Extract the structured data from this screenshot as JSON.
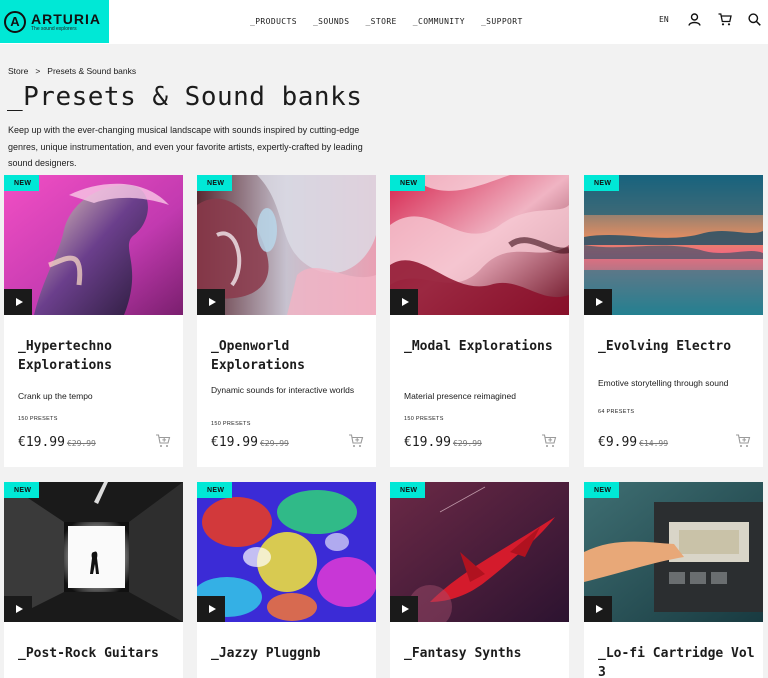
{
  "header": {
    "logo": {
      "name": "ARTURIA",
      "tagline": "The sound explorers"
    },
    "nav": [
      "_PRODUCTS",
      "_SOUNDS",
      "_STORE",
      "_COMMUNITY",
      "_SUPPORT"
    ],
    "lang": "EN",
    "icons": [
      "user-icon",
      "cart-icon",
      "search-icon"
    ]
  },
  "breadcrumb": {
    "parent": "Store",
    "separator": ">",
    "current": "Presets & Sound banks"
  },
  "page": {
    "title": "_Presets & Sound banks",
    "intro": "Keep up with the ever-changing musical landscape with sounds inspired by cutting-edge genres, unique instrumentation, and even your favorite artists, expertly-crafted by leading sound designers."
  },
  "cards": [
    {
      "badge": "NEW",
      "title": "_Hypertechno Explorations",
      "desc": "Crank up the tempo",
      "count": "150 PRESETS",
      "price": "€19.99",
      "old_price": "€29.99"
    },
    {
      "badge": "NEW",
      "title": "_Openworld Explorations",
      "desc": "Dynamic sounds for interactive worlds",
      "count": "150 PRESETS",
      "price": "€19.99",
      "old_price": "€29.99"
    },
    {
      "badge": "NEW",
      "title": "_Modal Explorations",
      "desc": "Material presence reimagined",
      "count": "150 PRESETS",
      "price": "€19.99",
      "old_price": "€29.99"
    },
    {
      "badge": "NEW",
      "title": "_Evolving Electro",
      "desc": "Emotive storytelling through sound",
      "count": "64 PRESETS",
      "price": "€9.99",
      "old_price": "€14.99"
    },
    {
      "badge": "NEW",
      "title": "_Post-Rock Guitars"
    },
    {
      "badge": "NEW",
      "title": "_Jazzy Pluggnb"
    },
    {
      "badge": "NEW",
      "title": "_Fantasy Synths"
    },
    {
      "badge": "NEW",
      "title": "_Lo-fi Cartridge Vol 3"
    }
  ],
  "colors": {
    "accent": "#00e8d6",
    "background": "#f2f2f2",
    "card": "#ffffff",
    "text": "#1c1c1c"
  }
}
